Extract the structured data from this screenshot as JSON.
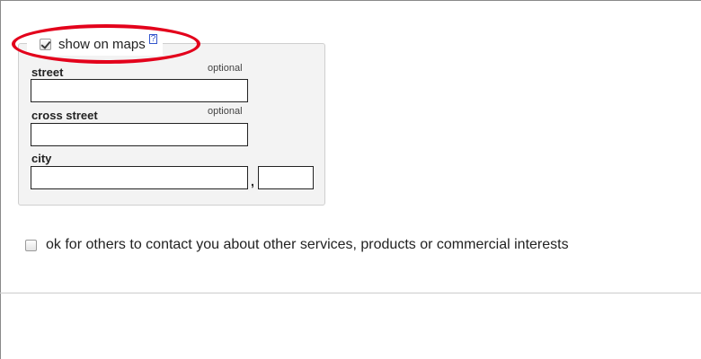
{
  "location": {
    "show_on_maps_label": "show on maps",
    "show_on_maps_checked": true,
    "help_link": "?",
    "street": {
      "label": "street",
      "optional": "optional",
      "value": ""
    },
    "cross_street": {
      "label": "cross street",
      "optional": "optional",
      "value": ""
    },
    "city": {
      "label": "city",
      "value": "",
      "region_value": "",
      "separator": ","
    }
  },
  "contact_ok": {
    "label": "ok for others to contact you about other services, products or commercial interests",
    "checked": false
  },
  "annotation": {
    "color": "#e3001b"
  }
}
